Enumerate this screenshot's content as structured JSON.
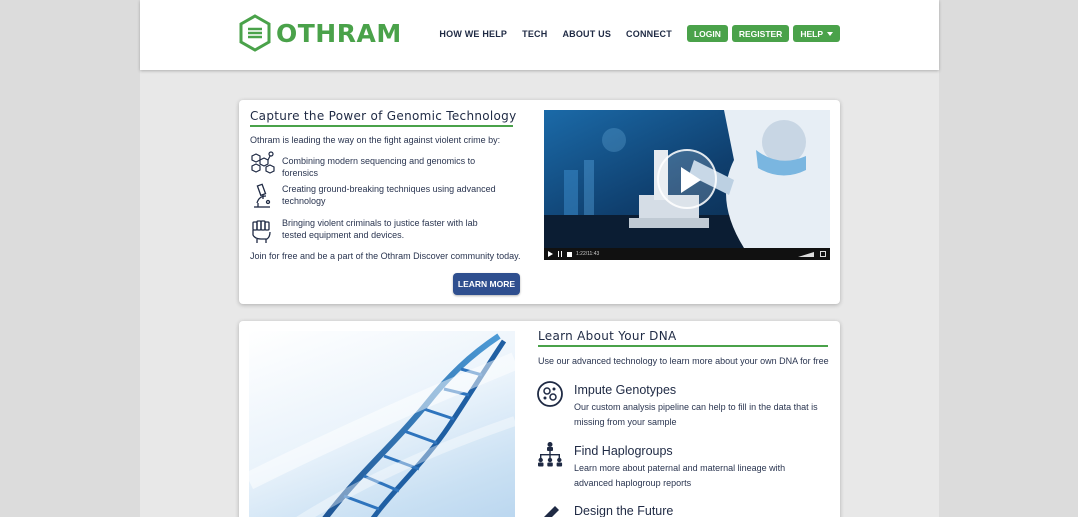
{
  "brand": {
    "name": "OTHRAM",
    "color": "#4aa24a"
  },
  "nav": {
    "links": [
      "HOW WE HELP",
      "TECH",
      "ABOUT US",
      "CONNECT"
    ],
    "login": "LOGIN",
    "register": "REGISTER",
    "help": "HELP"
  },
  "genomic": {
    "title": "Capture the Power of Genomic Technology",
    "intro": "Othram is leading the way on the fight against violent crime by:",
    "features": [
      {
        "icon": "molecule-icon",
        "text": "Combining modern sequencing and genomics to forensics"
      },
      {
        "icon": "microscope-icon",
        "text": "Creating ground-breaking techniques using advanced technology"
      },
      {
        "icon": "fist-icon",
        "text": "Bringing violent criminals to justice faster with lab tested equipment and devices."
      }
    ],
    "join": "Join for free and be a part of the Othram Discover community today.",
    "learn_more": "LEARN MORE",
    "video": {
      "time": "1:22/11:43"
    }
  },
  "dna": {
    "title": "Learn About Your DNA",
    "subtitle": "Use our advanced technology to learn more about your own DNA for free",
    "items": [
      {
        "icon": "dna-cell-icon",
        "title": "Impute Genotypes",
        "desc": "Our custom analysis pipeline can help to fill in the data that is missing from your sample"
      },
      {
        "icon": "family-tree-icon",
        "title": "Find Haplogroups",
        "desc": "Learn more about paternal and maternal lineage with advanced haplogroup reports"
      },
      {
        "icon": "pen-icon",
        "title": "Design the Future",
        "desc": ""
      }
    ]
  }
}
